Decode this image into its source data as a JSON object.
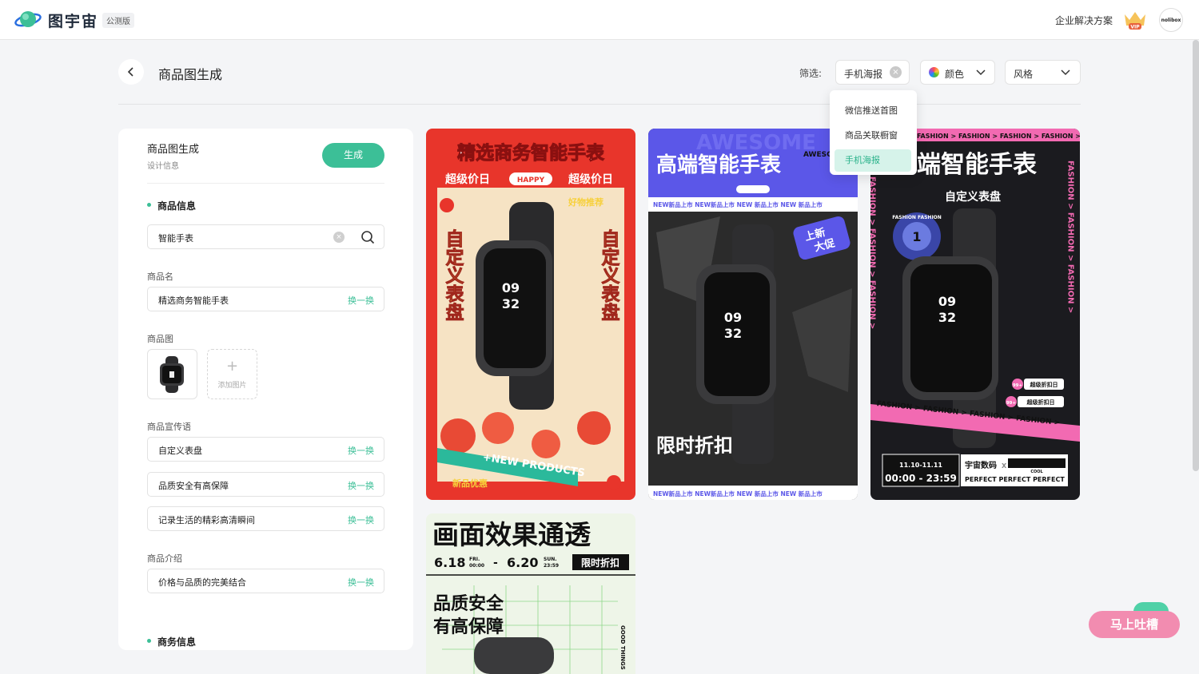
{
  "app": {
    "name": "图宇宙",
    "badge": "公测版",
    "enterprise_link": "企业解决方案",
    "vip_label": "VIP",
    "avatar_text": "nolibox"
  },
  "page": {
    "title": "商品图生成"
  },
  "filters": {
    "label": "筛选:",
    "type_value": "手机海报",
    "color_label": "颜色",
    "style_label": "风格",
    "dropdown_options": [
      "微信推送首图",
      "商品关联橱窗",
      "手机海报"
    ],
    "dropdown_selected": "手机海报"
  },
  "panel": {
    "title": "商品图生成",
    "subtitle": "设计信息",
    "generate_label": "生成",
    "section_product": "商品信息",
    "search_value": "智能手表",
    "name_label": "商品名",
    "name_value": "精选商务智能手表",
    "swap_label": "换一换",
    "image_label": "商品图",
    "add_image_label": "添加图片",
    "slogan_label": "商品宣传语",
    "slogans": [
      "自定义表盘",
      "品质安全有高保障",
      "记录生活的精彩高清瞬间"
    ],
    "intro_label": "商品介绍",
    "intro_value": "价格与品质的完美结合",
    "section_business": "商务信息"
  },
  "posters": {
    "p1": {
      "title": "精选商务智能手表",
      "sub_left": "超级价日",
      "happy": "HAPPY",
      "sub_right": "超级价日",
      "tag": "好物推荐",
      "side_left": "自定义表盘",
      "side_right": "自定义表盘",
      "banner": "+NEW PRODUCTS",
      "footer_tag": "新品优惠",
      "time_top": "09",
      "time_bottom": "32"
    },
    "p2": {
      "bg_word": "AWESOME",
      "title": "高端智能手表",
      "awesome": "AWESOME",
      "ticker": "NEW新品上市  NEW新品上市  NEW 新品上市  NEW 新品上市",
      "badge_line1": "上新",
      "badge_line2": "大促",
      "promo": "限时折扣",
      "time_top": "09",
      "time_bottom": "32"
    },
    "p3": {
      "ticker": "FASHION > FASHION > FASHION > FASHION >",
      "title": "端智能手表",
      "subtitle": "自定义表盘",
      "vertical": "FASHION > FASHION > FASHION >",
      "tag1": "超级折扣日",
      "tag2": "超级折扣日",
      "tag_count": "99+",
      "stripe": "FASHION > FASHION > FASHION > FASHION >",
      "date": "11.10-11.11",
      "time": "00:00 - 23:59",
      "brand": "宇宙数码",
      "brand_x": "X",
      "barcode_label": "COOL",
      "perfect": "PERFECT PERFECT PERFECT",
      "sticker_text": "FASHION FASHION",
      "sticker_num": "1",
      "time_top": "09",
      "time_bottom": "32"
    },
    "p4": {
      "title": "画面效果通透",
      "date_start": "6.18",
      "fri": "FRI.",
      "time_start": "00:00",
      "dash": "-",
      "date_end": "6.20",
      "sun": "SUN.",
      "time_end": "23:59",
      "promo": "限时折扣",
      "slogan1": "品质安全",
      "slogan2": "有高保障",
      "vertical": "GOOD THINGS"
    }
  },
  "feedback": {
    "label": "马上吐槽"
  },
  "colors": {
    "accent": "#3cbf97",
    "p1_red": "#e8352b",
    "p2_blue": "#5b57e8",
    "p3_dark": "#1b1b1f",
    "p3_pink": "#f26ab2"
  }
}
